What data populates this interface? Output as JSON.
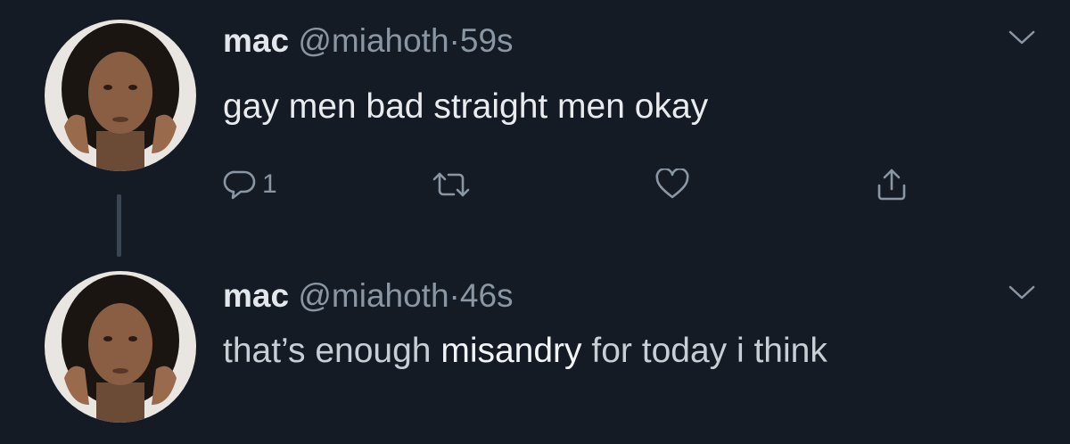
{
  "colors": {
    "background": "#141b25",
    "text_primary": "#e9ebee",
    "text_secondary": "#8a96a3",
    "thread_line": "#3b4655"
  },
  "tweets": [
    {
      "name": "mac",
      "handle": "@miahoth",
      "separator": "·",
      "time": "59s",
      "text": "gay men bad straight men okay",
      "actions": {
        "reply_icon": "reply-icon",
        "reply_count": "1",
        "retweet_icon": "retweet-icon",
        "like_icon": "heart-icon",
        "share_icon": "share-icon"
      },
      "menu_icon": "chevron-down-icon"
    },
    {
      "name": "mac",
      "handle": "@miahoth",
      "separator": "·",
      "time": "46s",
      "text_part1": "that’s enough ",
      "text_emphasis": "misandry",
      "text_part2": " for today i think",
      "menu_icon": "chevron-down-icon"
    }
  ]
}
